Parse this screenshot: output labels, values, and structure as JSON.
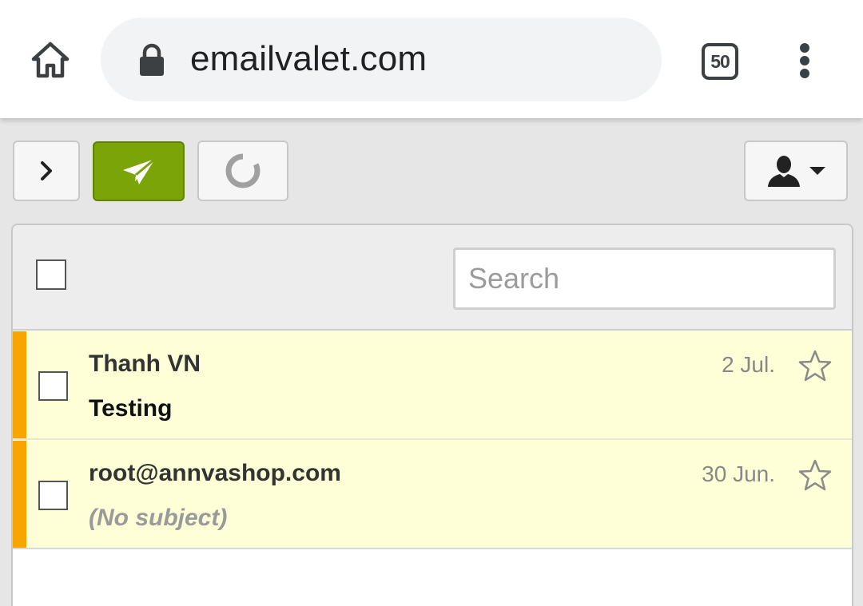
{
  "browser": {
    "url": "emailvalet.com",
    "tab_count": "50",
    "icons": {
      "home": "home-icon",
      "lock": "lock-icon",
      "tabs": "tab-switcher-icon",
      "menu": "more-vert-icon"
    }
  },
  "toolbar": {
    "icons": {
      "expand": "chevron-right-icon",
      "compose": "paper-plane-icon",
      "refresh": "loading-spinner-icon",
      "account": "user-icon"
    },
    "compose_color": "#7aa407"
  },
  "list": {
    "search_placeholder": "Search",
    "unread_color": "#f8a500",
    "row_bg": "#ffffd7",
    "messages": [
      {
        "sender": "Thanh VN",
        "subject": "Testing",
        "date": "2 Jul."
      },
      {
        "sender": "root@annvashop.com",
        "subject": "(No subject)",
        "date": "30 Jun."
      }
    ]
  }
}
